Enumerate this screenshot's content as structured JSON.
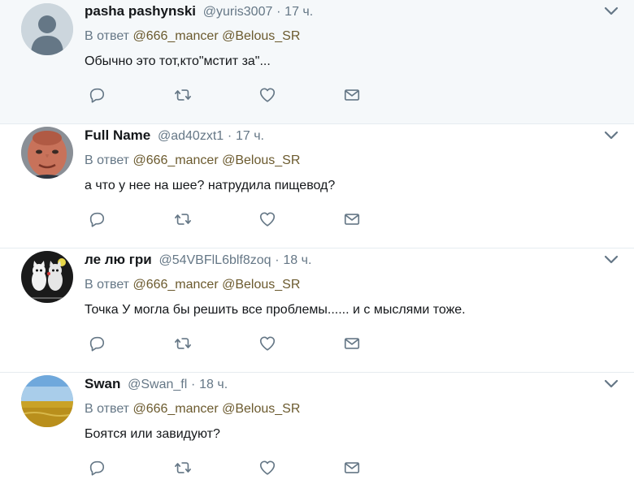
{
  "tweets": [
    {
      "fullname": "pasha pashynski",
      "username": "@yuris3007",
      "dot": "·",
      "time": "17 ч.",
      "replying_prefix": "В ответ",
      "mention1": "@666_mancer",
      "mention2": "@Belous_SR",
      "text": "Обычно это тот,кто\"мстит за\"...",
      "avatar": "default-avatar-icon",
      "highlight": true
    },
    {
      "fullname": "Full Name",
      "username": "@ad40zxt1",
      "dot": "·",
      "time": "17 ч.",
      "replying_prefix": "В ответ",
      "mention1": "@666_mancer",
      "mention2": "@Belous_SR",
      "text": "а что у нее на шее? натрудила пищевод?",
      "avatar": "face-photo-avatar",
      "highlight": false
    },
    {
      "fullname": "ле лю гри",
      "username": "@54VBFlL6blf8zoq",
      "dot": "·",
      "time": "18 ч.",
      "replying_prefix": "В ответ",
      "mention1": "@666_mancer",
      "mention2": "@Belous_SR",
      "text": "Точка У могла бы решить все проблемы...... и с мыслями тоже.",
      "avatar": "cartoon-cats-avatar",
      "highlight": false
    },
    {
      "fullname": "Swan",
      "username": "@Swan_fl",
      "dot": "·",
      "time": "18 ч.",
      "replying_prefix": "В ответ",
      "mention1": "@666_mancer",
      "mention2": "@Belous_SR",
      "text": "Боятся или завидуют?",
      "avatar": "wheat-field-avatar",
      "highlight": false
    }
  ],
  "icons": {
    "reply": "reply-icon",
    "retweet": "retweet-icon",
    "like": "heart-icon",
    "dm": "envelope-icon",
    "caret": "chevron-down-icon"
  },
  "colors": {
    "icon": "#657786",
    "mention": "#6b5a2e",
    "highlight_bg": "#f5f8fa",
    "divider": "#e6ecf0"
  }
}
